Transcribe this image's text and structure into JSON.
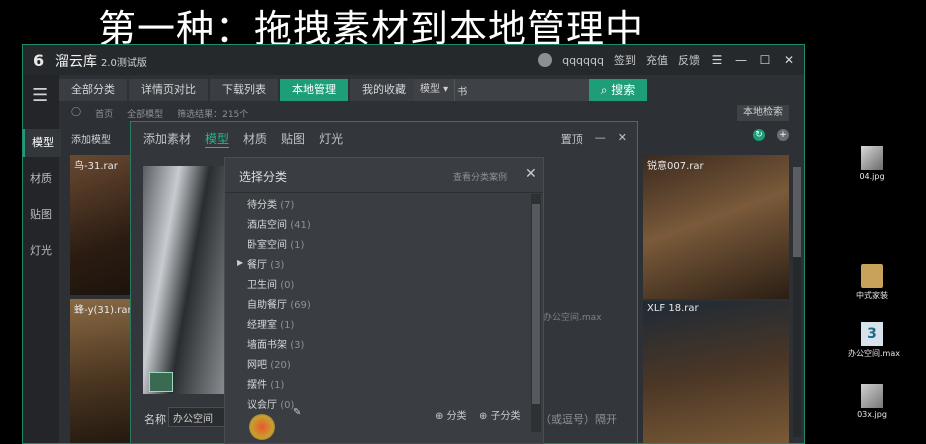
{
  "overlay_title": "第一种：拖拽素材到本地管理中",
  "app": {
    "name": "溜云库",
    "version": "2.0测试版",
    "user": "qqqqqq",
    "title_actions": [
      "签到",
      "充值",
      "反馈"
    ],
    "nav_tabs": [
      "全部分类",
      "详情页对比",
      "下载列表",
      "本地管理",
      "我的收藏"
    ],
    "active_tab": "本地管理",
    "search": {
      "category": "模型",
      "value": "书",
      "button": "搜索"
    },
    "breadcrumbs": [
      "首页",
      "全部模型",
      "筛选结果：215个"
    ],
    "local_search": "本地检索",
    "sidebar": [
      "模型",
      "材质",
      "贴图",
      "灯光"
    ],
    "add_model": "添加模型",
    "cards": {
      "c1": "鸟-31.rar",
      "c2": "蜂-y(31).rar",
      "c3": "锐意007.rar",
      "c4": "XLF 18.rar",
      "c_mid": "办公空间.max"
    }
  },
  "add_dialog": {
    "title": "添加素材",
    "tabs": [
      "模型",
      "材质",
      "贴图",
      "灯光"
    ],
    "active": "模型",
    "pin": "置顶",
    "name_label": "名称",
    "name_value": "办公空间",
    "hint": "（或逗号）隔开"
  },
  "category_dialog": {
    "title": "选择分类",
    "link": "查看分类案例",
    "items": [
      {
        "name": "待分类",
        "count": "(7)"
      },
      {
        "name": "酒店空间",
        "count": "(41)"
      },
      {
        "name": "卧室空间",
        "count": "(1)"
      },
      {
        "name": "餐厅",
        "count": "(3)"
      },
      {
        "name": "卫生间",
        "count": "(0)"
      },
      {
        "name": "自助餐厅",
        "count": "(69)"
      },
      {
        "name": "经理室",
        "count": "(1)"
      },
      {
        "name": "墙面书架",
        "count": "(3)"
      },
      {
        "name": "网吧",
        "count": "(20)"
      },
      {
        "name": "摆件",
        "count": "(1)"
      },
      {
        "name": "议会厅",
        "count": "(0)"
      }
    ],
    "add_category": "分类",
    "add_subcategory": "子分类"
  },
  "desktop": [
    {
      "label": "04.jpg"
    },
    {
      "label": "中式家装"
    },
    {
      "label": "办公空间.max"
    },
    {
      "label": "03x.jpg"
    }
  ],
  "colors": {
    "accent": "#1d9e78",
    "bg": "#2d3034"
  }
}
